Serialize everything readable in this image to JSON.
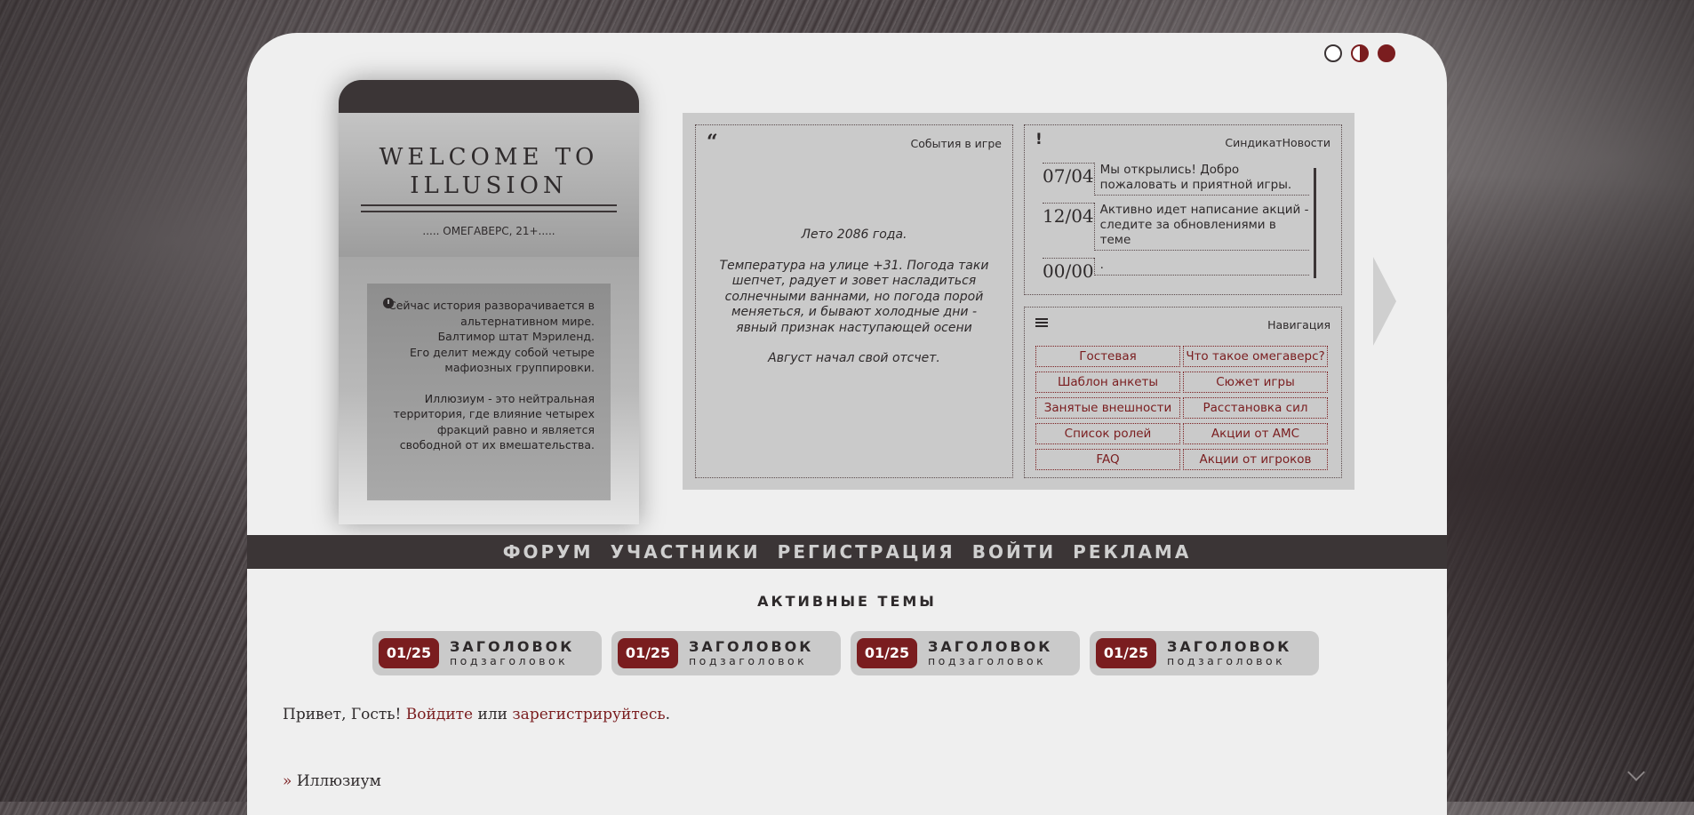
{
  "theme_switch": [
    "light",
    "half",
    "dark"
  ],
  "welcome": {
    "title_line1": "WELCOME TO",
    "title_line2": "ILLUSION",
    "subtitle": "..... ОМЕГАВЕРС, 21+.....",
    "story_icon": "clock-icon",
    "story_p1": "Сейчас история разворачивается в альтернативном мире.\nБалтимор штат Мэриленд.\nЕго делит между собой четыре мафиозных группировки.",
    "story_p2": "Иллюзиум - это нейтральная территория, где влияние четырех фракций равно и является свободной от их вмешательства."
  },
  "events": {
    "icon": "quote-icon",
    "title": "События в игре",
    "p1": "Лето 2086 года.",
    "p2": "Температура на улице +31. Погода таки шепчет, радует и зовет насладиться солнечными ваннами, но погода порой меняеться, и бывают холодные дни - явный признак наступающей осени",
    "p3": "Август начал свой отсчет."
  },
  "news": {
    "icon": "exclamation-icon",
    "title": "СиндикатНовости",
    "items": [
      {
        "date": "07/04",
        "text": "Мы открылись! Добро пожаловать и приятной игры."
      },
      {
        "date": "12/04",
        "text": "Активно идет написание акций - следите за обновлениями в теме"
      },
      {
        "date": "00/00",
        "text": "."
      }
    ]
  },
  "nav": {
    "icon": "list-icon",
    "title": "Навигация",
    "links": [
      "Гостевая",
      "Что такое омегаверс?",
      "Шаблон анкеты",
      "Сюжет игры",
      "Занятые внешности",
      "Расстановка сил",
      "Список ролей",
      "Акции от АМС",
      "FAQ",
      "Акции от игроков"
    ]
  },
  "menu": [
    "ФОРУМ",
    "УЧАСТНИКИ",
    "РЕГИСТРАЦИЯ",
    "ВОЙТИ",
    "РЕКЛАМА"
  ],
  "active_topics": {
    "title": "АКТИВНЫЕ ТЕМЫ",
    "items": [
      {
        "badge": "01/25",
        "title": "ЗАГОЛОВОК",
        "subtitle": "подзаголовок"
      },
      {
        "badge": "01/25",
        "title": "ЗАГОЛОВОК",
        "subtitle": "подзаголовок"
      },
      {
        "badge": "01/25",
        "title": "ЗАГОЛОВОК",
        "subtitle": "подзаголовок"
      },
      {
        "badge": "01/25",
        "title": "ЗАГОЛОВОК",
        "subtitle": "подзаголовок"
      }
    ]
  },
  "greeting": {
    "prefix": "Привет, Гость! ",
    "login": "Войдите",
    "middle": " или ",
    "register": "зарегистрируйтесь",
    "suffix": "."
  },
  "forum_category": {
    "marker": "»",
    "name": "Иллюзиум"
  },
  "colors": {
    "accent": "#7a1d1f",
    "dark": "#3b3536",
    "panel": "#cacaca",
    "page": "#efefef"
  }
}
